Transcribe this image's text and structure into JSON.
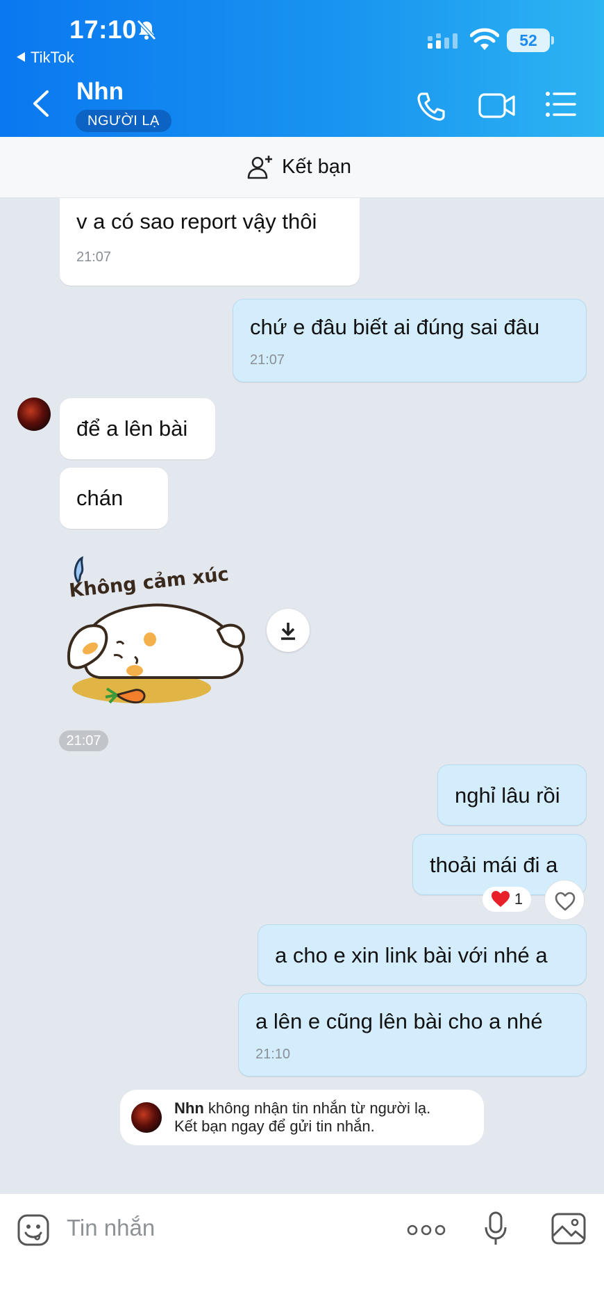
{
  "status_bar": {
    "time": "17:10",
    "back_app": "TikTok",
    "battery": "52"
  },
  "header": {
    "name": "Nhn",
    "badge": "NGƯỜI LẠ"
  },
  "add_friend": {
    "label": "Kết bạn"
  },
  "messages": {
    "m1": {
      "text": "v a có sao report vậy thôi",
      "time": "21:07"
    },
    "m2": {
      "text": "chứ e đâu biết ai đúng sai đâu",
      "time": "21:07"
    },
    "m3": {
      "text": "để a lên bài"
    },
    "m4": {
      "text": "chán"
    },
    "sticker": {
      "caption": "Không cảm xúc",
      "time": "21:07"
    },
    "m5": {
      "text": "nghỉ lâu rồi"
    },
    "m6": {
      "text": "thoải mái đi a",
      "reaction_count": "1"
    },
    "m7": {
      "text": "a cho e xin link bài với nhé a"
    },
    "m8": {
      "text": "a lên e cũng lên bài cho a nhé",
      "time": "21:10"
    }
  },
  "notice": {
    "name": "Nhn",
    "line1": "không nhận tin nhắn từ người lạ.",
    "line2": "Kết bạn ngay để gửi tin nhắn."
  },
  "input": {
    "placeholder": "Tin nhắn"
  },
  "colors": {
    "header_start": "#0a78f0",
    "header_end": "#2db4f2",
    "outgoing_bubble": "#d4edfc",
    "background": "#e3e7ee"
  }
}
